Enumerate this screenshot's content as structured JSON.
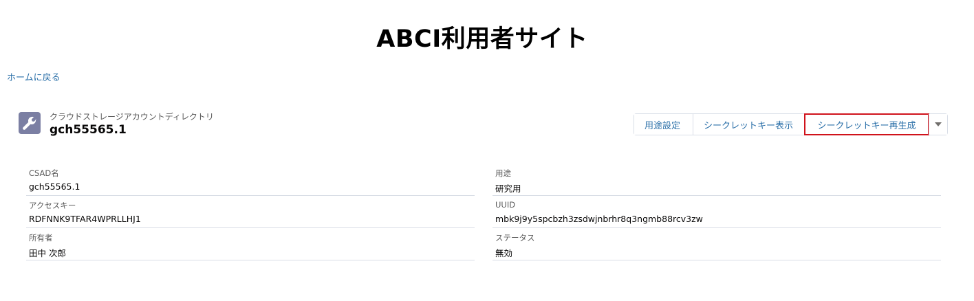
{
  "site": {
    "title": "ABCI利用者サイト",
    "home_link": "ホームに戻る"
  },
  "record": {
    "type_label": "クラウドストレージアカウントディレクトリ",
    "name": "gch55565.1",
    "icon": "wrench-icon",
    "icon_bg": "#7b7fa3"
  },
  "actions": {
    "purpose_setting": "用途設定",
    "show_secret_key": "シークレットキー表示",
    "regenerate_secret_key": "シークレットキー再生成",
    "more_icon": "chevron-down-icon"
  },
  "fields": {
    "left": [
      {
        "label": "CSAD名",
        "value": "gch55565.1"
      },
      {
        "label": "アクセスキー",
        "value": "RDFNNK9TFAR4WPRLLHJ1"
      },
      {
        "label": "所有者",
        "value": "田中 次郎"
      }
    ],
    "right": [
      {
        "label": "用途",
        "value": "研究用"
      },
      {
        "label": "UUID",
        "value": "mbk9j9y5spcbzh3zsdwjnbrhr8q3ngmb88rcv3zw"
      },
      {
        "label": "ステータス",
        "value": "無効"
      }
    ]
  },
  "colors": {
    "link": "#2a6fa8",
    "highlight": "#d0121b"
  }
}
